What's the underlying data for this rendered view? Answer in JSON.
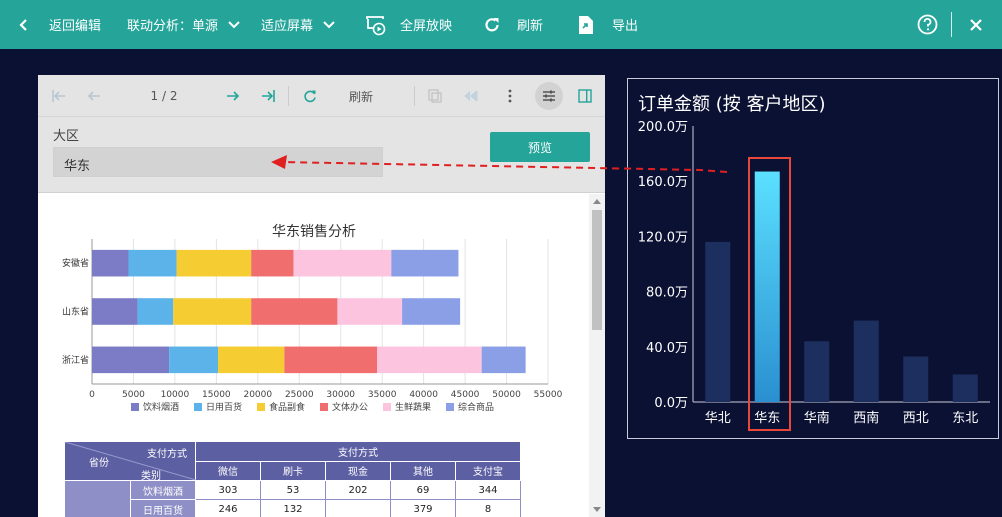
{
  "topbar": {
    "back_label": "返回编辑",
    "linkage_label": "联动分析：单源",
    "fit_label": "适应屏幕",
    "fullscreen_label": "全屏放映",
    "refresh_label": "刷新",
    "export_label": "导出",
    "help_icon": "question-circle-icon",
    "close_icon": "close-icon"
  },
  "report": {
    "page_indicator": "1 / 2",
    "refresh_label": "刷新",
    "param_label": "大区",
    "param_value": "华东",
    "preview_label": "预览"
  },
  "chart_data": [
    {
      "type": "bar",
      "orientation": "horizontal",
      "stacked": true,
      "title": "华东销售分析",
      "categories": [
        "浙江省",
        "山东省",
        "安徽省"
      ],
      "series": [
        {
          "name": "饮料烟酒",
          "color": "#7b7bc6",
          "values": [
            9300,
            5500,
            4400
          ]
        },
        {
          "name": "日用百货",
          "color": "#5bb3ea",
          "values": [
            5900,
            4300,
            5800
          ]
        },
        {
          "name": "食品副食",
          "color": "#f5cd33",
          "values": [
            8000,
            9400,
            9000
          ]
        },
        {
          "name": "文体办公",
          "color": "#f06e6e",
          "values": [
            11200,
            10400,
            5100
          ]
        },
        {
          "name": "生鲜蔬果",
          "color": "#fcc4df",
          "values": [
            12600,
            7800,
            11800
          ]
        },
        {
          "name": "综合商品",
          "color": "#8b9fe6",
          "values": [
            5300,
            7000,
            8100
          ]
        }
      ],
      "xticks": [
        "0",
        "5000",
        "10000",
        "15000",
        "20000",
        "25000",
        "30000",
        "35000",
        "40000",
        "45000",
        "50000",
        "55000"
      ],
      "xlim": [
        0,
        55000
      ],
      "legend_position": "bottom",
      "grid": true
    },
    {
      "type": "bar",
      "title": "订单金额 (按 客户地区)",
      "categories": [
        "华北",
        "华东",
        "华南",
        "西南",
        "西北",
        "东北"
      ],
      "values": [
        116,
        167,
        44,
        59,
        33,
        20
      ],
      "selected": "华东",
      "ylim": [
        0,
        200
      ],
      "yticks": [
        "0.0万",
        "40.0万",
        "80.0万",
        "120.0万",
        "160.0万",
        "200.0万"
      ],
      "unit": "万",
      "colors": {
        "bar": "#1d2f5e",
        "selected_top": "#5be0ff",
        "selected_bottom": "#2a8fd0",
        "highlight": "#e8473a",
        "link_arrow": "#e02020"
      }
    }
  ],
  "pivot": {
    "corner_top": "支付方式",
    "corner_left": "省份",
    "corner_mid": "类别",
    "group_header": "支付方式",
    "columns": [
      "微信",
      "刷卡",
      "现金",
      "其他",
      "支付宝"
    ],
    "rows": [
      {
        "category": "饮料烟酒",
        "cells": [
          "303",
          "53",
          "202",
          "69",
          "344"
        ]
      },
      {
        "category": "日用百货",
        "cells": [
          "246",
          "132",
          "",
          "379",
          "8"
        ]
      }
    ]
  }
}
